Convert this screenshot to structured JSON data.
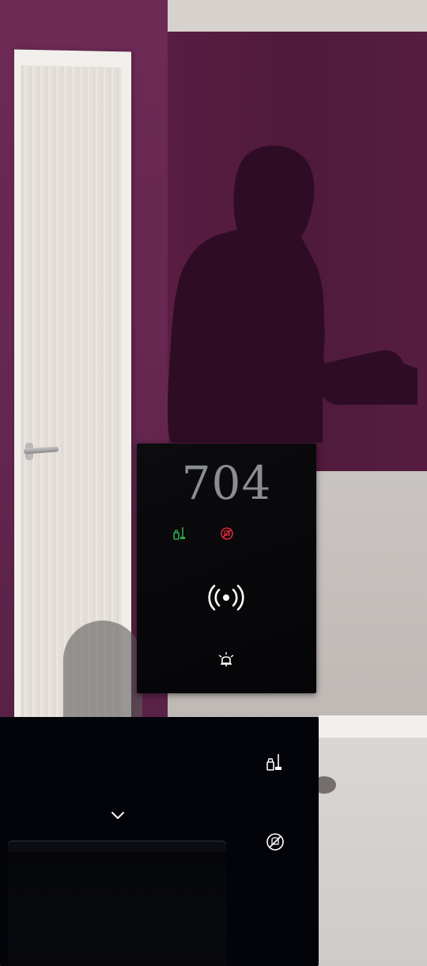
{
  "scene": {
    "room_number": "704",
    "colors": {
      "wall": "#5a1d43",
      "device_bg": "#050507",
      "indicator_green": "#2ea84a",
      "indicator_red": "#d8293a",
      "icon_white": "#ffffff",
      "number_gray": "#8a8d92"
    }
  },
  "device": {
    "icons": [
      "clean-room-icon",
      "do-not-disturb-icon",
      "nfc-wireless-icon",
      "doorbell-icon"
    ]
  },
  "panel": {
    "icons": [
      "clean-room-icon",
      "do-not-disturb-icon",
      "chevron-down-icon",
      "card-slot"
    ]
  }
}
